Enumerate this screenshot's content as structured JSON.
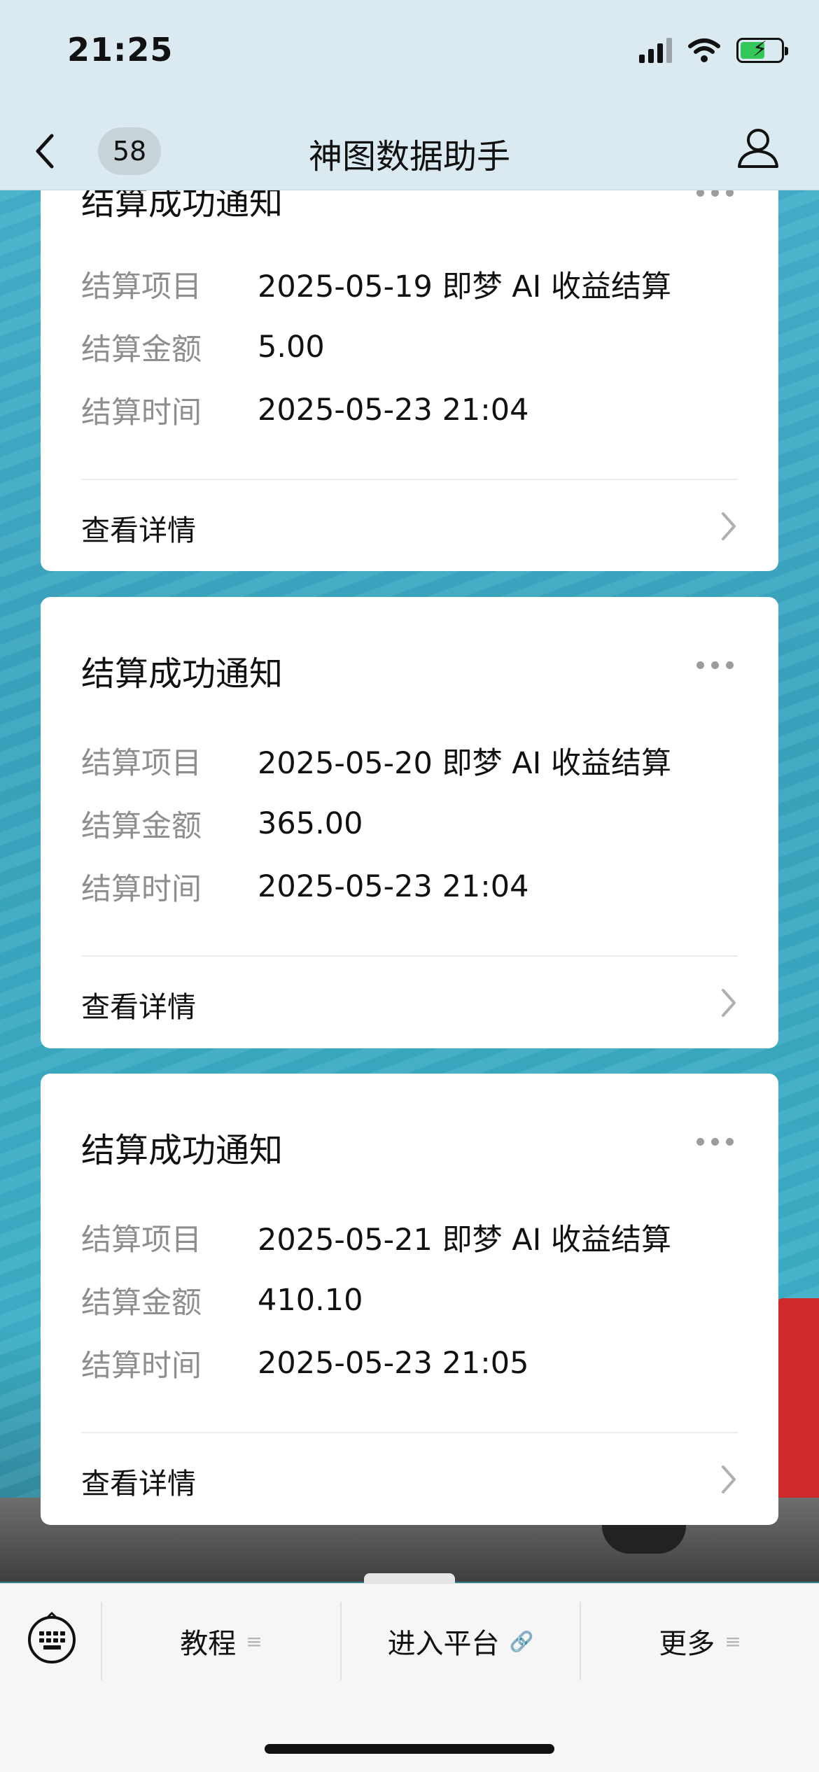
{
  "status_bar": {
    "time": "21:25",
    "icons": [
      "signal-icon",
      "wifi-icon",
      "battery-charging-icon"
    ]
  },
  "nav": {
    "back_icon": "chevron-left-icon",
    "unread_count": "58",
    "title": "神图数据助手",
    "profile_icon": "person-icon"
  },
  "cards": [
    {
      "title": "结算成功通知",
      "rows": [
        {
          "label": "结算项目",
          "value": "2025-05-19 即梦 AI 收益结算"
        },
        {
          "label": "结算金额",
          "value": "5.00"
        },
        {
          "label": "结算时间",
          "value": "2025-05-23 21:04"
        }
      ],
      "detail_label": "查看详情"
    },
    {
      "title": "结算成功通知",
      "rows": [
        {
          "label": "结算项目",
          "value": "2025-05-20 即梦 AI 收益结算"
        },
        {
          "label": "结算金额",
          "value": "365.00"
        },
        {
          "label": "结算时间",
          "value": "2025-05-23 21:04"
        }
      ],
      "detail_label": "查看详情"
    },
    {
      "title": "结算成功通知",
      "rows": [
        {
          "label": "结算项目",
          "value": "2025-05-21 即梦 AI 收益结算"
        },
        {
          "label": "结算金额",
          "value": "410.10"
        },
        {
          "label": "结算时间",
          "value": "2025-05-23 21:05"
        }
      ],
      "detail_label": "查看详情"
    }
  ],
  "bottom_menu": {
    "keyboard_icon": "keyboard-icon",
    "items": [
      {
        "label": "教程",
        "suffix": "≡"
      },
      {
        "label": "进入平台",
        "suffix": "🔗"
      },
      {
        "label": "更多",
        "suffix": "≡"
      }
    ]
  },
  "colors": {
    "header_bg": "#dbeaf0",
    "chat_bg": "#3fa9c3",
    "card_bg": "#ffffff",
    "label_gray": "#8e8e8e"
  }
}
